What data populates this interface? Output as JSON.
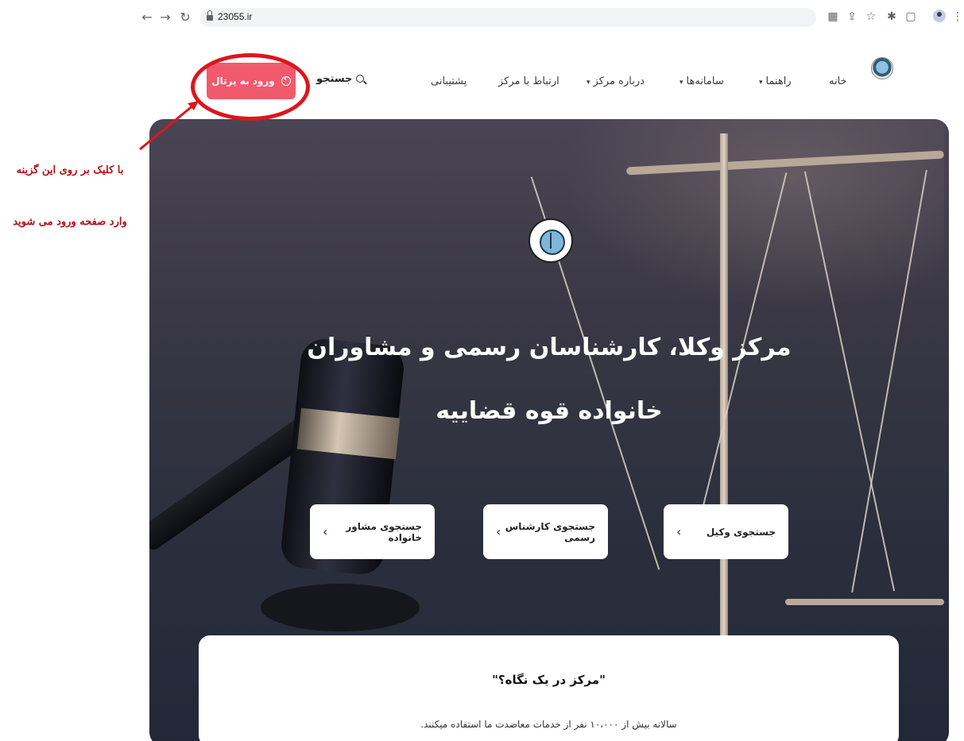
{
  "browser": {
    "url": "23055.ir",
    "back_icon": "back-arrow-icon",
    "forward_icon": "forward-arrow-icon",
    "reload_icon": "reload-icon",
    "extension_icons": [
      "translate-icon",
      "share-icon",
      "star-icon",
      "puzzle-icon",
      "side-panel-icon",
      "profile-icon",
      "more-menu-icon"
    ]
  },
  "header": {
    "nav": [
      {
        "label": "خانه"
      },
      {
        "label": "راهنما",
        "has_dropdown": true
      },
      {
        "label": "سامانه‌ها",
        "has_dropdown": true
      },
      {
        "label": "درباره مرکز",
        "has_dropdown": true
      },
      {
        "label": "ارتباط با مرکز"
      },
      {
        "label": "پشتیبانی"
      }
    ],
    "search_label": "جستجو",
    "portal_button": "ورود به پرتال",
    "caret": "▾"
  },
  "annotation": {
    "line1": "با کلیک بر روی این گزینه",
    "line2": "وارد صفحه ورود می شوید",
    "color": "#e0141e"
  },
  "hero": {
    "title_line1": "مرکز وکلا، کارشناسان رسمی و مشاوران",
    "title_line2": "خانواده قوه قضاییه",
    "search_cards": [
      {
        "label": "جستجوی وکیل",
        "chevron": "›"
      },
      {
        "label": "جستجوی کارشناس رسمی",
        "chevron": "›"
      },
      {
        "label": "جستجوی مشاور خانواده",
        "chevron": "›"
      }
    ]
  },
  "info": {
    "title": "\"مرکز در یک نگاه؟\"",
    "text": "سالانه بیش از ۱۰،۰۰۰ نفر از خدمات معاضدت ما استفاده میکنند."
  },
  "colors": {
    "portal_button": "#f05a6c",
    "annotation": "#b01116"
  }
}
